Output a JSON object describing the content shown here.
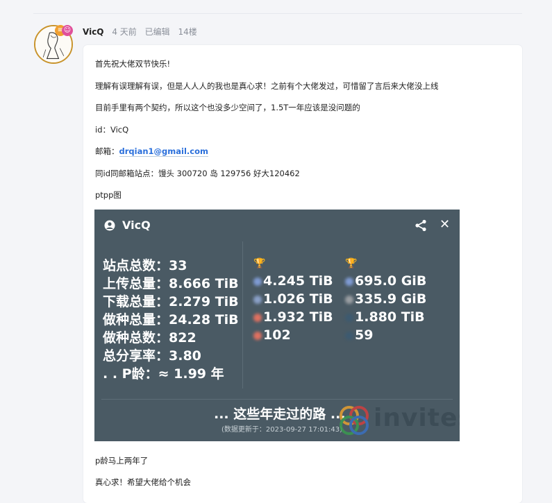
{
  "post": {
    "username": "VicQ",
    "time": "4 天前",
    "edited": "已编辑",
    "floor": "14楼",
    "paragraphs": {
      "p1": "首先祝大佬双节快乐!",
      "p2": "理解有误理解有误，但是人人人的我也是真心求！之前有个大佬发过，可惜留了言后来大佬没上线",
      "p3": "目前手里有两个契约，所以这个也没多少空间了，1.5T一年应该是没问题的",
      "p4": "id：VicQ",
      "p5_label": "邮箱：",
      "p5_email": "drqian1@gmail.com",
      "p6": "同id同邮箱站点：馒头 300720 岛 129756 好大120462",
      "p7": "ptpp图",
      "p8": "p龄马上两年了",
      "p9": "真心求！希望大佬给个机会"
    }
  },
  "stats_image": {
    "name": "VicQ",
    "rows": [
      "站点总数：33",
      "上传总量：8.666 TiB",
      "下载总量：2.279 TiB",
      "做种总量：24.28 TiB",
      "做种总数：822",
      "总分享率：3.80",
      ". .  P龄：≈ 1.99 年"
    ],
    "col1": [
      "4.245 TiB",
      "1.026 TiB",
      "1.932 TiB",
      "102"
    ],
    "col2": [
      "695.0 GiB",
      "335.9 GiB",
      "1.880 TiB",
      "59"
    ],
    "footer": "... 这些年走过的路 ...",
    "updated": "(数据更新于：2023-09-27 17:01:43)",
    "watermark": "invites"
  },
  "colors": {
    "card_bg": "#4a5a64",
    "link": "#2a6fdb",
    "gold": "#c9a227",
    "silver": "#b0b6bb"
  },
  "icons": {
    "user": "user-circle-icon",
    "share": "share-icon",
    "close": "close-icon",
    "trophy_gold": "trophy-icon",
    "trophy_silver": "trophy-icon"
  }
}
